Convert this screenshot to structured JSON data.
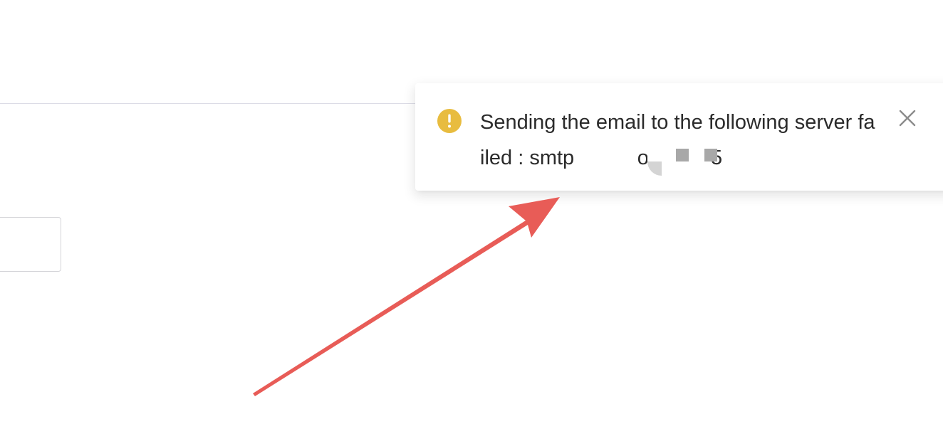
{
  "notification": {
    "type": "warning",
    "message": "Sending the email to the following server failed : smtp           om.cn:25",
    "icon": "exclamation-circle-icon",
    "close_icon": "close-icon",
    "accent_color": "#e8bc3f"
  },
  "annotation": {
    "arrow_color": "#e85c57"
  }
}
